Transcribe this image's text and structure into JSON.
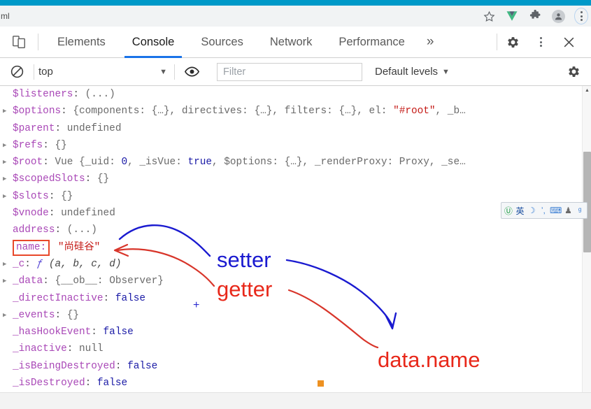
{
  "browser": {
    "accent_strip_color": "#0099c8",
    "omnibox_url_fragment": "ml",
    "icons": {
      "bookmark_star": "star-icon",
      "vue_devtools": "vue-devtools-icon",
      "extensions": "puzzle-piece-icon",
      "profile": "profile-avatar-icon",
      "menu": "kebab-menu-icon"
    }
  },
  "devtools": {
    "device_toolbar_label": "device-toolbar",
    "tabs": [
      {
        "label": "Elements",
        "active": false
      },
      {
        "label": "Console",
        "active": true
      },
      {
        "label": "Sources",
        "active": false
      },
      {
        "label": "Network",
        "active": false
      },
      {
        "label": "Performance",
        "active": false
      }
    ],
    "more_tabs_glyph": "»",
    "active_tab_underline_color": "#1a73e8",
    "right_actions": [
      "settings-gear",
      "more-options-kebab",
      "close-devtools"
    ]
  },
  "console_toolbar": {
    "clear_label": "clear-console",
    "context": "top",
    "context_caret": "▼",
    "eye_label": "live-expressions",
    "filter_placeholder": "Filter",
    "filter_value": "",
    "levels_label": "Default levels",
    "levels_caret": "▼",
    "settings_label": "console-settings"
  },
  "console_rows": [
    {
      "expandable": false,
      "key": "$listeners",
      "sep": ": ",
      "value": "(...)",
      "value_class": "txt"
    },
    {
      "expandable": true,
      "key": "$options",
      "sep": ": ",
      "segments": [
        {
          "t": "{components: {…}, directives: {…}, filters: {…}, el: ",
          "c": "txt"
        },
        {
          "t": "\"#root\"",
          "c": "v-str"
        },
        {
          "t": ", _b…",
          "c": "txt"
        }
      ]
    },
    {
      "expandable": false,
      "key": "$parent",
      "sep": ": ",
      "value": "undefined",
      "value_class": "txt"
    },
    {
      "expandable": true,
      "key": "$refs",
      "sep": ": ",
      "value": "{}",
      "value_class": "txt"
    },
    {
      "expandable": true,
      "key": "$root",
      "sep": ": ",
      "segments": [
        {
          "t": "Vue {_uid: ",
          "c": "txt"
        },
        {
          "t": "0",
          "c": "v-num"
        },
        {
          "t": ", _isVue: ",
          "c": "txt"
        },
        {
          "t": "true",
          "c": "v-bool"
        },
        {
          "t": ", $options: {…}, _renderProxy: Proxy, _se…",
          "c": "txt"
        }
      ]
    },
    {
      "expandable": true,
      "key": "$scopedSlots",
      "sep": ": ",
      "value": "{}",
      "value_class": "txt"
    },
    {
      "expandable": true,
      "key": "$slots",
      "sep": ": ",
      "value": "{}",
      "value_class": "txt"
    },
    {
      "expandable": false,
      "key": "$vnode",
      "sep": ": ",
      "value": "undefined",
      "value_class": "txt"
    },
    {
      "expandable": false,
      "key": "address",
      "sep": ": ",
      "value": "(...)",
      "value_class": "txt"
    },
    {
      "expandable": false,
      "key": "name",
      "sep": ": ",
      "boxed": true,
      "value": "\"尚硅谷\"",
      "value_class": "v-str"
    },
    {
      "expandable": true,
      "key": "_c",
      "sep": ": ",
      "segments": [
        {
          "t": "ƒ ",
          "c": "fn-f"
        },
        {
          "t": "(a, b, c, d)",
          "c": "v-italic"
        }
      ]
    },
    {
      "expandable": true,
      "key": "_data",
      "sep": ": ",
      "value": "{__ob__: Observer}",
      "value_class": "txt"
    },
    {
      "expandable": false,
      "key": "_directInactive",
      "sep": ": ",
      "value": "false",
      "value_class": "v-bool"
    },
    {
      "expandable": true,
      "key": "_events",
      "sep": ": ",
      "value": "{}",
      "value_class": "txt"
    },
    {
      "expandable": false,
      "key": "_hasHookEvent",
      "sep": ": ",
      "value": "false",
      "value_class": "v-bool"
    },
    {
      "expandable": false,
      "key": "_inactive",
      "sep": ": ",
      "value": "null",
      "value_class": "v-null"
    },
    {
      "expandable": false,
      "key": "_isBeingDestroyed",
      "sep": ": ",
      "value": "false",
      "value_class": "v-bool"
    },
    {
      "expandable": false,
      "key": "_isDestroyed",
      "sep": ": ",
      "value": "false",
      "value_class": "v-bool"
    }
  ],
  "annotations": {
    "setter": {
      "text": "setter",
      "color": "#1a1ad0"
    },
    "getter": {
      "text": "getter",
      "color": "#e8281a"
    },
    "data_name": {
      "text": "data.name",
      "color": "#e8281a"
    },
    "highlight_box_color": "#e8482a",
    "cursor_plus": "+"
  },
  "ime_bar": {
    "items": [
      {
        "name": "ime-logo-icon",
        "glyph": "Ⓤ"
      },
      {
        "name": "ime-language-chinese-icon",
        "glyph": "英"
      },
      {
        "name": "ime-halfwidth-moon-icon",
        "glyph": "☽"
      },
      {
        "name": "ime-punctuation-icon",
        "glyph": "ʼ,"
      },
      {
        "name": "ime-soft-keyboard-icon",
        "glyph": "⌨"
      },
      {
        "name": "ime-user-icon",
        "glyph": "♟"
      },
      {
        "name": "ime-toolbox-wrench-icon",
        "glyph": "ᵍ"
      }
    ]
  },
  "scrollbar": {
    "name": "console-scrollbar",
    "thumb_top_pct": 19,
    "thumb_height_pct": 33
  }
}
